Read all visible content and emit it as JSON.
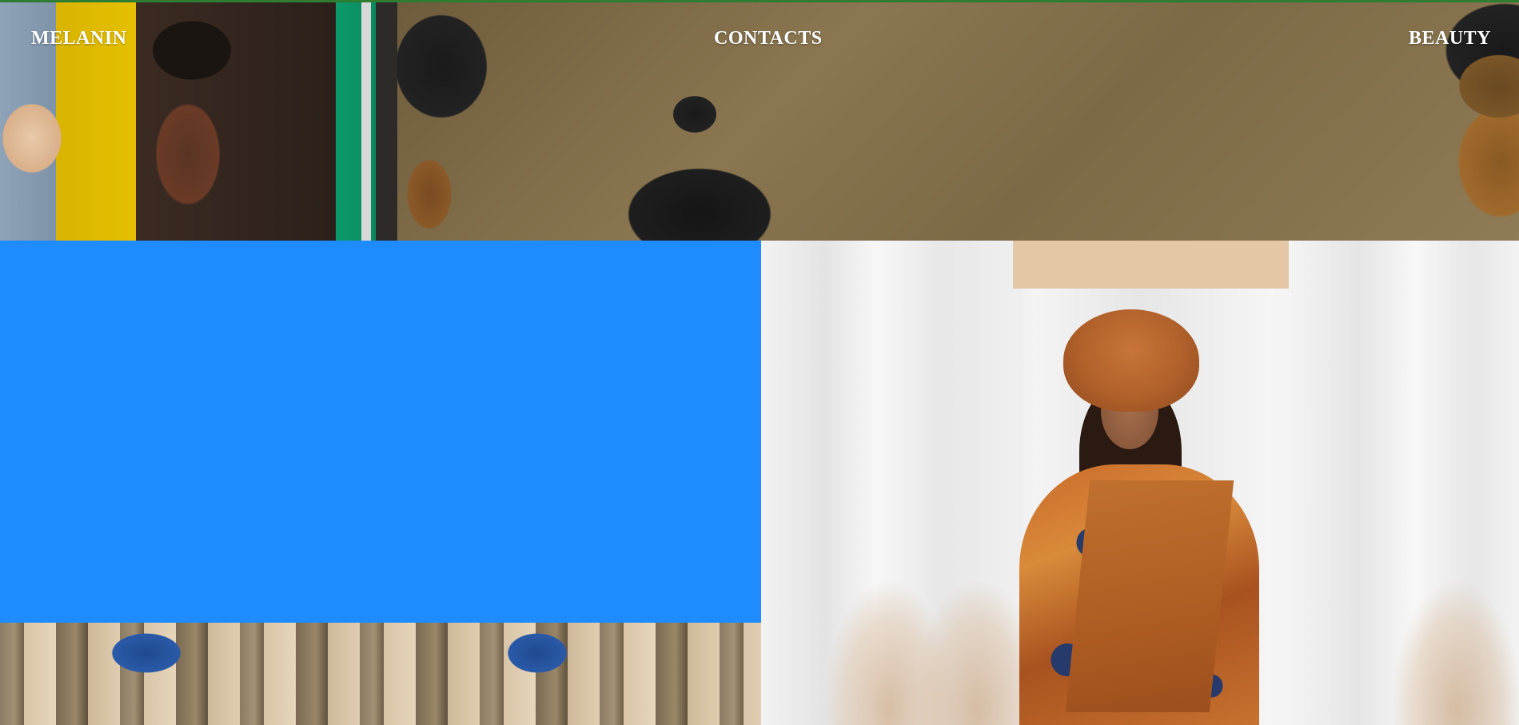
{
  "nav": {
    "left": "MELANIN",
    "center": "CONTACTS",
    "right": "BEAUTY"
  },
  "colors": {
    "accent_blue": "#1e8bff",
    "top_border_green": "#2e7d32",
    "nav_text": "#ffffff"
  },
  "images": {
    "banner": "banner-photo-traditional-hairstyles",
    "right": "photo-woman-orange-gele",
    "bottom": "photo-bamboo-and-blue-pots"
  }
}
